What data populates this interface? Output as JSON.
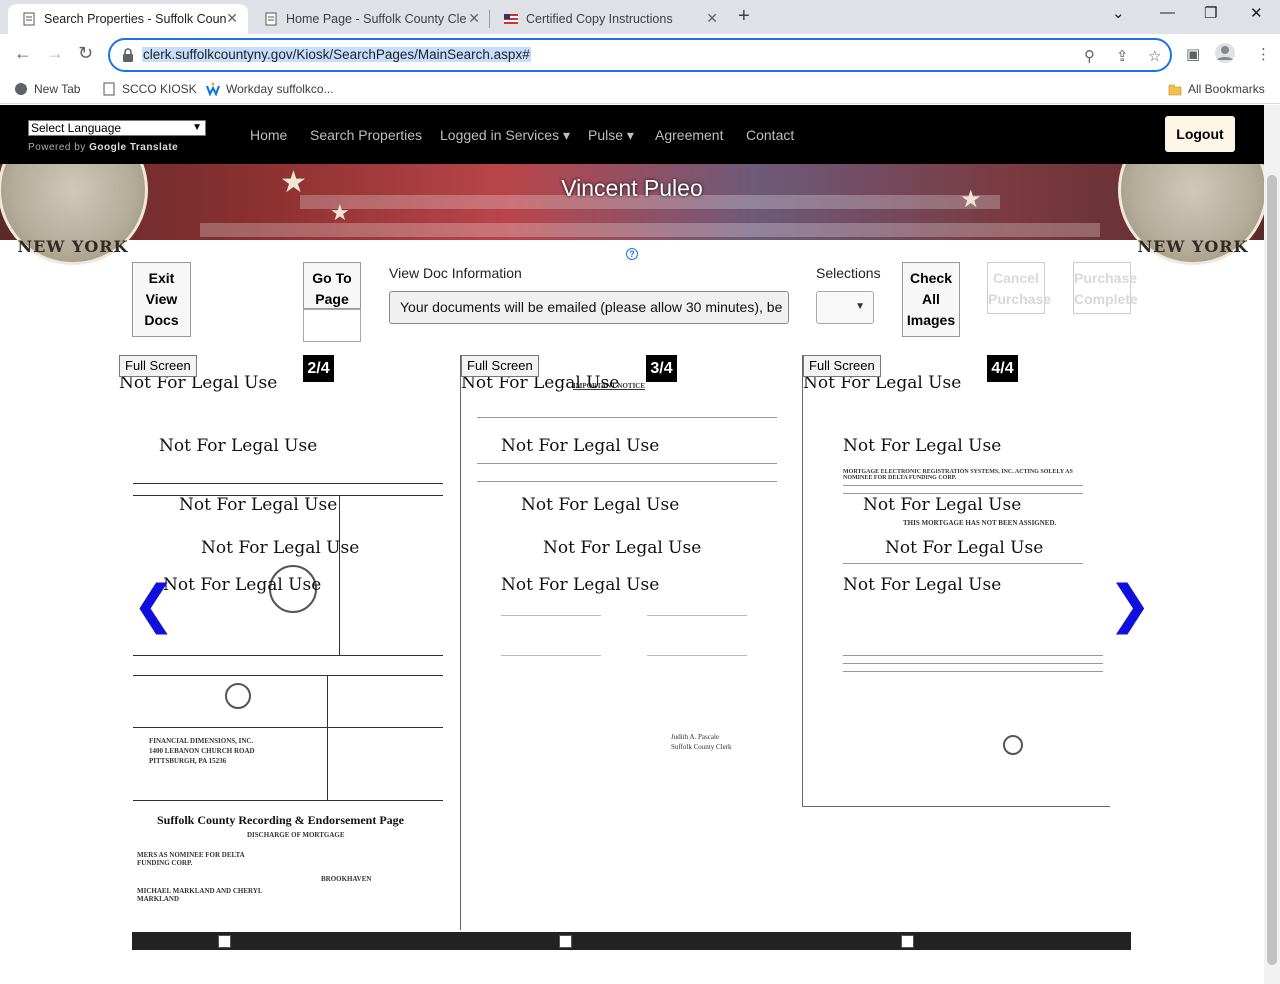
{
  "browser": {
    "tabs": [
      {
        "title": "Search Properties - Suffolk Coun"
      },
      {
        "title": "Home Page - Suffolk County Cle"
      },
      {
        "title": "Certified Copy Instructions"
      }
    ],
    "url": "clerk.suffolkcountyny.gov/Kiosk/SearchPages/MainSearch.aspx#",
    "bookmarks": [
      "New Tab",
      "SCCO KIOSK",
      "Workday suffolkco...",
      "All Bookmarks"
    ]
  },
  "site": {
    "language_select": "Select Language",
    "powered_by": "Powered by",
    "google_translate": "Google Translate",
    "nav": [
      "Home",
      "Search Properties",
      "Logged in Services ▾",
      "Pulse ▾",
      "Agreement",
      "Contact"
    ],
    "logout": "Logout",
    "clerk_name": "Vincent Puleo",
    "seal_text": "NEW YORK"
  },
  "controls": {
    "exit_view_docs": "Exit View Docs",
    "go_to_page": "Go To Page",
    "view_doc_info_label": "View Doc Information",
    "view_doc_info_value": "Your documents will be emailed (please allow 30 minutes), be",
    "selections_label": "Selections",
    "check_all_images": "Check All Images",
    "cancel_purchase": "Cancel Purchase",
    "purchase_complete": "Purchase Complete",
    "help_icon": "?"
  },
  "viewer": {
    "full_screen": "Full Screen",
    "watermark": "Not For Legal Use",
    "pages": [
      {
        "num": "2/4",
        "title": "Suffolk County Recording & Endorsement Page",
        "return_to": "FINANCIAL DIMENSIONS, INC.",
        "address1": "1400 LEBANON CHURCH ROAD",
        "address2": "PITTSBURGH, PA 15236",
        "mortgage": "DISCHARGE OF MORTGAGE",
        "party1": "MERS AS NOMINEE FOR DELTA FUNDING CORP.",
        "party2": "MICHAEL MARKLAND AND CHERYL MARKLAND",
        "township": "BROOKHAVEN"
      },
      {
        "num": "3/4",
        "heading": "IMPORTANT NOTICE",
        "signer": "Judith A. Pascale",
        "signer_title": "Suffolk County Clerk"
      },
      {
        "num": "4/4",
        "heading": "MORTGAGE ELECTRONIC REGISTRATION SYSTEMS, INC. ACTING SOLELY AS NOMINEE FOR DELTA FUNDING CORP.",
        "not_assigned": "THIS MORTGAGE HAS NOT BEEN ASSIGNED."
      }
    ],
    "prev_arrow": "❮",
    "next_arrow": "❯"
  }
}
